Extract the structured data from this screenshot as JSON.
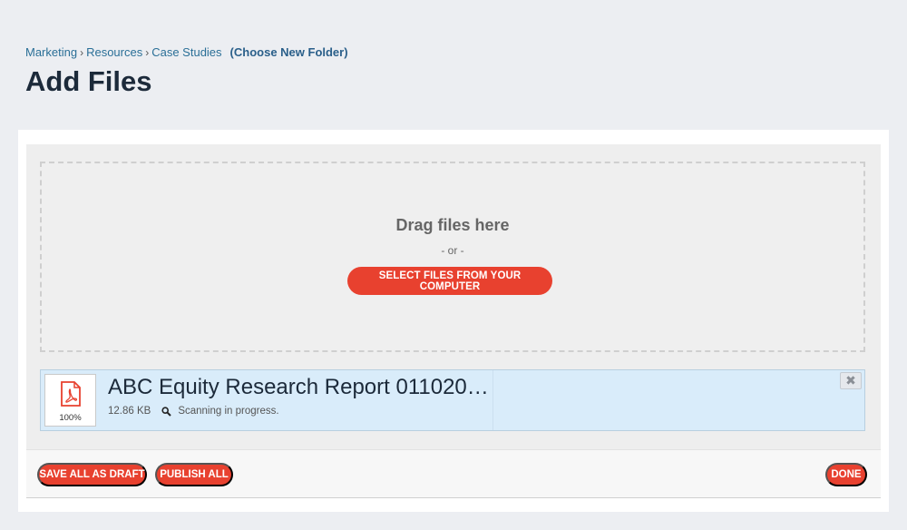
{
  "breadcrumb": {
    "items": [
      "Marketing",
      "Resources",
      "Case Studies"
    ],
    "separator": "›",
    "choose_folder": "(Choose New Folder)"
  },
  "page_title": "Add Files",
  "dropzone": {
    "title": "Drag files here",
    "or_text": "- or -",
    "select_button": "SELECT FILES FROM YOUR COMPUTER"
  },
  "file": {
    "name": "ABC Equity Research Report 011020…",
    "size": "12.86 KB",
    "status": "Scanning in progress.",
    "progress": "100%",
    "icon": "pdf-file-icon",
    "close_symbol": "✖"
  },
  "footer": {
    "save_draft": "SAVE ALL AS DRAFT",
    "publish_all": "PUBLISH ALL",
    "done": "DONE"
  },
  "colors": {
    "accent": "#e8412f",
    "link": "#2a6f97",
    "file_row_bg": "#d9ecfa",
    "page_bg": "#eceef2"
  }
}
